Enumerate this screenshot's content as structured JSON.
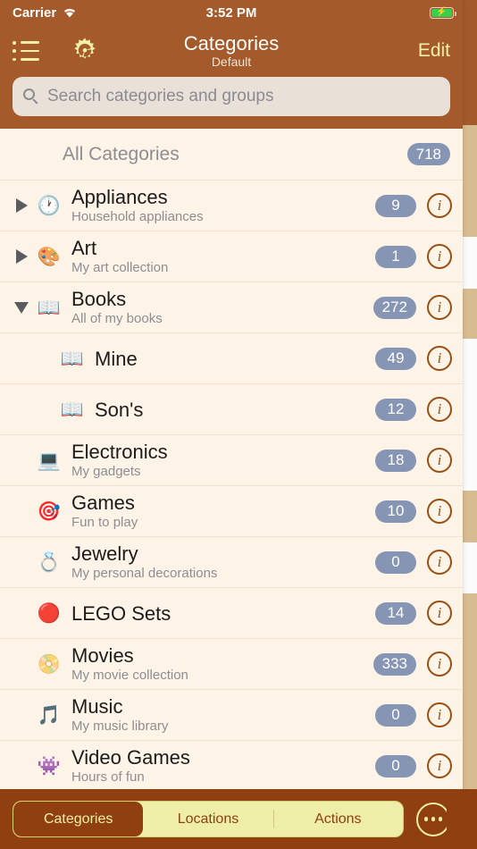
{
  "status_bar": {
    "carrier": "Carrier",
    "wifi_icon": "wifi-icon",
    "time": "3:52 PM",
    "battery_icon": "battery-charging-icon",
    "battery_bolt": "⚡"
  },
  "nav_bar": {
    "list_icon": "bulleted-list-icon",
    "gear_icon": "gear-icon",
    "title": "Categories",
    "subtitle": "Default",
    "edit_label": "Edit"
  },
  "search": {
    "icon": "search-icon",
    "placeholder": "Search categories and groups",
    "value": ""
  },
  "list": {
    "all_categories": {
      "label": "All Categories",
      "count": "718"
    },
    "rows": [
      {
        "name": "Appliances",
        "subtitle": "Household appliances",
        "count": "9",
        "emoji": "🕐",
        "emoji_name": "clock-icon",
        "disclosure": "collapsed",
        "level": 0
      },
      {
        "name": "Art",
        "subtitle": "My art collection",
        "count": "1",
        "emoji": "🎨",
        "emoji_name": "palette-icon",
        "disclosure": "collapsed",
        "level": 0
      },
      {
        "name": "Books",
        "subtitle": "All of my books",
        "count": "272",
        "emoji": "📖",
        "emoji_name": "open-book-icon",
        "disclosure": "expanded",
        "level": 0
      },
      {
        "name": "Mine",
        "subtitle": "",
        "count": "49",
        "emoji": "📖",
        "emoji_name": "open-book-icon",
        "disclosure": "none",
        "level": 1
      },
      {
        "name": "Son's",
        "subtitle": "",
        "count": "12",
        "emoji": "📖",
        "emoji_name": "open-book-icon",
        "disclosure": "none",
        "level": 1
      },
      {
        "name": "Electronics",
        "subtitle": "My gadgets",
        "count": "18",
        "emoji": "💻",
        "emoji_name": "laptop-icon",
        "disclosure": "none",
        "level": 0
      },
      {
        "name": "Games",
        "subtitle": "Fun to play",
        "count": "10",
        "emoji": "🎯",
        "emoji_name": "dart-icon",
        "disclosure": "none",
        "level": 0
      },
      {
        "name": "Jewelry",
        "subtitle": "My personal decorations",
        "count": "0",
        "emoji": "💍",
        "emoji_name": "ring-icon",
        "disclosure": "none",
        "level": 0
      },
      {
        "name": "LEGO Sets",
        "subtitle": "",
        "count": "14",
        "emoji": "🔴",
        "emoji_name": "red-circle-icon",
        "disclosure": "none",
        "level": 0
      },
      {
        "name": "Movies",
        "subtitle": "My movie collection",
        "count": "333",
        "emoji": "📀",
        "emoji_name": "dvd-icon",
        "disclosure": "none",
        "level": 0
      },
      {
        "name": "Music",
        "subtitle": "My music library",
        "count": "0",
        "emoji": "🎵",
        "emoji_name": "music-note-icon",
        "disclosure": "none",
        "level": 0
      },
      {
        "name": "Video Games",
        "subtitle": "Hours of fun",
        "count": "0",
        "emoji": "👾",
        "emoji_name": "alien-monster-icon",
        "disclosure": "none",
        "level": 0
      }
    ],
    "info_glyph": "i"
  },
  "toolbar": {
    "segments": [
      {
        "label": "Categories",
        "selected": true
      },
      {
        "label": "Locations",
        "selected": false
      },
      {
        "label": "Actions",
        "selected": false
      }
    ],
    "more_icon": "more-ellipsis-icon"
  },
  "colors": {
    "nav_brown": "#a55a2b",
    "toolbar_brown": "#8f3f10",
    "accent_yellow": "#f2f0a8",
    "list_bg": "#fdf3e7",
    "badge_blue": "#8795b5",
    "info_brown": "#9a4f12",
    "peek_tan": "#d8bc91"
  }
}
